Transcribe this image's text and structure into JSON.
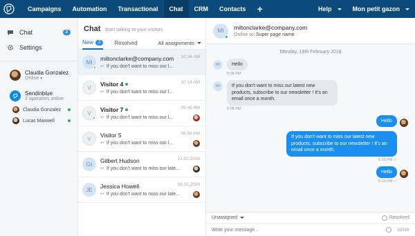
{
  "topbar": {
    "nav": [
      "Campaigns",
      "Automation",
      "Transactional",
      "Chat",
      "CRM",
      "Contacts"
    ],
    "active": "Chat",
    "plus": "+",
    "help": "Help",
    "account": "Mon petit gazon"
  },
  "sidebar": {
    "chat_label": "Chat",
    "chat_count": "2",
    "settings_label": "Settings",
    "user": {
      "name": "Claudia Gonzalez",
      "status": "Online"
    },
    "company": {
      "name": "Sendinblue",
      "operators": "2 operators online"
    },
    "operators": [
      {
        "name": "Claudia Gonzalez"
      },
      {
        "name": "Lucas Maxwell"
      }
    ]
  },
  "convlist": {
    "title": "Chat",
    "subtitle": "Start talking to your visitors",
    "tab_new": "New",
    "tab_new_count": "2",
    "tab_resolved": "Resolved",
    "filter": "All assignments",
    "items": [
      {
        "initials": "MI",
        "name": "miltonclarke@company.com",
        "time": "10:34 AM",
        "msg": "If you don't want to miss our l..."
      },
      {
        "initials": "V",
        "name": "Visitor 4",
        "time": "10:14 AM",
        "msg": "If you don't want to miss our l..."
      },
      {
        "initials": "V",
        "name": "Visitor 7",
        "time": "09:45 AM",
        "msg": "If you don't want to miss our l..."
      },
      {
        "initials": "V",
        "name": "Visitor 5",
        "time": "06:56 AM",
        "msg": "If you don't want to miss our l..."
      },
      {
        "initials": "GI",
        "name": "Gilbert Hudson",
        "time": "22.02.2018",
        "msg": "If you don't want to miss our late..."
      },
      {
        "initials": "JE",
        "name": "Jessica Howell",
        "time": "18.01.2018",
        "msg": "If you don't want to miss our late..."
      }
    ]
  },
  "chat": {
    "header_initials": "MI",
    "header_name": "miltonclarke@company.com",
    "status_prefix": "Online on",
    "status_page": "Super page name",
    "date": "Monday, 19th February 2018",
    "msg_in_initials": "MI",
    "in1": "Hello",
    "in1_time": "5:08 PM",
    "in2": "If you don't want to miss our latest new products, subscribe to our newsletter ! It's an email once a month.",
    "in2_time": "5:08 PM",
    "out1": "Hello",
    "out2": "If you don't want to miss our latest new products, subscribe to our newsletter ! It's an email once a month.",
    "out2_time": "5:10 PM",
    "out3": "Hello",
    "out3_time": "5:10 PM",
    "assign": "Unassigned",
    "resolved": "Resolved",
    "placeholder": "Write your message...",
    "send": "SEND"
  }
}
